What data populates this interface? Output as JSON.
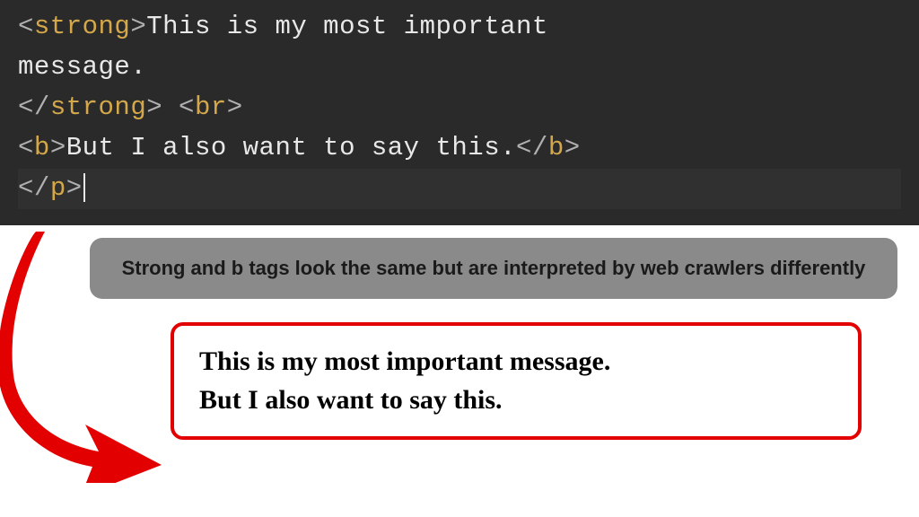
{
  "code": {
    "line1": {
      "open_bracket": "<",
      "tag": "strong",
      "close_bracket": ">",
      "text": "This is my most important"
    },
    "line2": {
      "text": "message."
    },
    "line3": {
      "close_open": "</",
      "tag1": "strong",
      "close_bracket1": ">",
      "space": " ",
      "open_bracket2": "<",
      "tag2": "br",
      "close_bracket2": ">"
    },
    "line4": {
      "open_bracket": "<",
      "tag1": "b",
      "close_bracket1": ">",
      "text": "But I also want to say this.",
      "close_open": "</",
      "tag2": "b",
      "close_bracket2": ">"
    },
    "line5": {
      "close_open": "</",
      "tag": "p",
      "close_bracket": ">"
    }
  },
  "caption": "Strong and b tags look the same but are interpreted by web crawlers differently",
  "output": {
    "line1": "This is my most important message.",
    "line2": "But I also want to say this."
  }
}
